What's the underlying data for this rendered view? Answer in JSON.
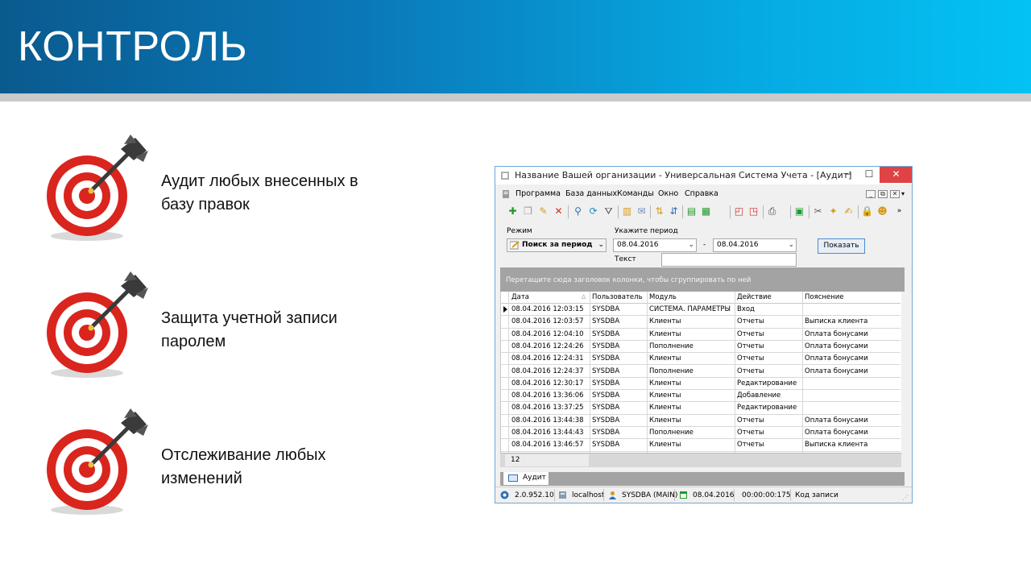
{
  "slide": {
    "title": "КОНТРОЛЬ",
    "bullets": [
      {
        "line1": "Аудит любых внесенных в",
        "line2": "базу правок"
      },
      {
        "line1": "Защита учетной записи",
        "line2": "паролем"
      },
      {
        "line1": "Отслеживание любых",
        "line2": "изменений"
      }
    ]
  },
  "window": {
    "title": "Название Вашей организации - Универсальная Система Учета - [Аудит]",
    "controls": {
      "minimize": "─",
      "maximize": "☐",
      "close": "✕"
    },
    "menu": [
      "Программа",
      "База данных",
      "Команды",
      "Окно",
      "Справка"
    ],
    "mdi_controls": {
      "minimize": "_",
      "restore": "⧉",
      "close": "✕",
      "more": "▾"
    },
    "filters": {
      "mode_label": "Режим",
      "mode_value": "Поиск за период",
      "period_label": "Укажите период",
      "date_from": "08.04.2016",
      "dash": "-",
      "date_to": "08.04.2016",
      "text_label": "Текст",
      "text_value": "",
      "show_button": "Показать"
    },
    "group_hint": "Перетащите сюда заголовок колонки, чтобы сгруппировать по ней",
    "columns": [
      "Дата",
      "Пользователь",
      "Модуль",
      "Действие",
      "Пояснение"
    ],
    "rows": [
      [
        "08.04.2016 12:03:15",
        "SYSDBA",
        "СИСТЕМА. ПАРАМЕТРЫ",
        "Вход",
        ""
      ],
      [
        "08.04.2016 12:03:57",
        "SYSDBA",
        "Клиенты",
        "Отчеты",
        "Выписка клиента"
      ],
      [
        "08.04.2016 12:04:10",
        "SYSDBA",
        "Клиенты",
        "Отчеты",
        "Оплата бонусами"
      ],
      [
        "08.04.2016 12:24:26",
        "SYSDBA",
        "Пополнение",
        "Отчеты",
        "Оплата бонусами"
      ],
      [
        "08.04.2016 12:24:31",
        "SYSDBA",
        "Клиенты",
        "Отчеты",
        "Оплата бонусами"
      ],
      [
        "08.04.2016 12:24:37",
        "SYSDBA",
        "Пополнение",
        "Отчеты",
        "Оплата бонусами"
      ],
      [
        "08.04.2016 12:30:17",
        "SYSDBA",
        "Клиенты",
        "Редактирование",
        ""
      ],
      [
        "08.04.2016 13:36:06",
        "SYSDBA",
        "Клиенты",
        "Добавление",
        ""
      ],
      [
        "08.04.2016 13:37:25",
        "SYSDBA",
        "Клиенты",
        "Редактирование",
        ""
      ],
      [
        "08.04.2016 13:44:38",
        "SYSDBA",
        "Клиенты",
        "Отчеты",
        "Оплата бонусами"
      ],
      [
        "08.04.2016 13:44:43",
        "SYSDBA",
        "Пополнение",
        "Отчеты",
        "Оплата бонусами"
      ],
      [
        "08.04.2016 13:46:57",
        "SYSDBA",
        "Клиенты",
        "Отчеты",
        "Выписка клиента"
      ]
    ],
    "record_count": "12",
    "tab_label": "Аудит",
    "status": {
      "version": "2.0.952.10",
      "host": "localhost",
      "user": "SYSDBA (MAIN)",
      "date": "08.04.2016",
      "time": "00:00:00:175",
      "record_code": "Код записи"
    }
  },
  "colors": {
    "banner_dark": "#0a5a8e",
    "banner_light": "#04c2f4",
    "target_red": "#d9251d",
    "close_red": "#e04343"
  }
}
